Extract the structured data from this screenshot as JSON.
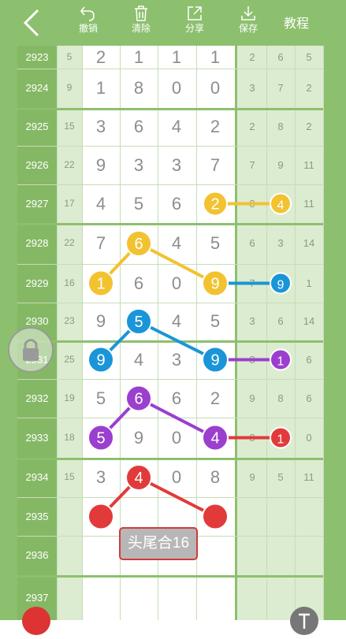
{
  "toolbar": {
    "undo": "撤销",
    "clear": "清除",
    "share": "分享",
    "save": "保存",
    "tutorial": "教程"
  },
  "rows": [
    {
      "issue": "2923",
      "sum": "5",
      "d": [
        "2",
        "1",
        "1",
        "1"
      ],
      "tail": [
        "2",
        "6",
        "5"
      ]
    },
    {
      "issue": "2924",
      "sum": "9",
      "d": [
        "1",
        "8",
        "0",
        "0"
      ],
      "tail": [
        "3",
        "7",
        "2"
      ]
    },
    {
      "issue": "2925",
      "sum": "15",
      "d": [
        "3",
        "6",
        "4",
        "2"
      ],
      "tail": [
        "2",
        "8",
        "2"
      ]
    },
    {
      "issue": "2926",
      "sum": "22",
      "d": [
        "9",
        "3",
        "3",
        "7"
      ],
      "tail": [
        "7",
        "9",
        "11"
      ]
    },
    {
      "issue": "2927",
      "sum": "17",
      "d": [
        "4",
        "5",
        "6",
        "2"
      ],
      "tail": [
        "8",
        "4",
        "11"
      ]
    },
    {
      "issue": "2928",
      "sum": "22",
      "d": [
        "7",
        "6",
        "4",
        "5"
      ],
      "tail": [
        "6",
        "3",
        "14"
      ]
    },
    {
      "issue": "2929",
      "sum": "16",
      "d": [
        "1",
        "6",
        "0",
        "9"
      ],
      "tail": [
        "7",
        "9",
        "1"
      ]
    },
    {
      "issue": "2930",
      "sum": "23",
      "d": [
        "9",
        "5",
        "4",
        "5"
      ],
      "tail": [
        "3",
        "6",
        "14"
      ]
    },
    {
      "issue": "2931",
      "sum": "25",
      "d": [
        "9",
        "4",
        "3",
        "9"
      ],
      "tail": [
        "8",
        "1",
        "6"
      ]
    },
    {
      "issue": "2932",
      "sum": "19",
      "d": [
        "5",
        "6",
        "6",
        "2"
      ],
      "tail": [
        "9",
        "8",
        "6"
      ]
    },
    {
      "issue": "2933",
      "sum": "18",
      "d": [
        "5",
        "9",
        "0",
        "4"
      ],
      "tail": [
        "8",
        "1",
        "0"
      ]
    },
    {
      "issue": "2934",
      "sum": "15",
      "d": [
        "3",
        "4",
        "0",
        "8"
      ],
      "tail": [
        "9",
        "5",
        "11"
      ]
    },
    {
      "issue": "2935",
      "sum": "",
      "d": [
        "",
        "",
        "",
        ""
      ],
      "tail": [
        "",
        "",
        ""
      ]
    },
    {
      "issue": "2936",
      "sum": "",
      "d": [
        "",
        "",
        "",
        ""
      ],
      "tail": [
        "",
        "",
        ""
      ]
    },
    {
      "issue": "2937",
      "sum": "",
      "d": [
        "",
        "",
        "",
        ""
      ],
      "tail": [
        "",
        "",
        ""
      ]
    }
  ],
  "badge": "头尾合16",
  "colors": {
    "green": "#8cc06e",
    "yellow": "#f2c230",
    "blue": "#1a95d8",
    "purple": "#9b3fcf",
    "red": "#e23a3a"
  }
}
